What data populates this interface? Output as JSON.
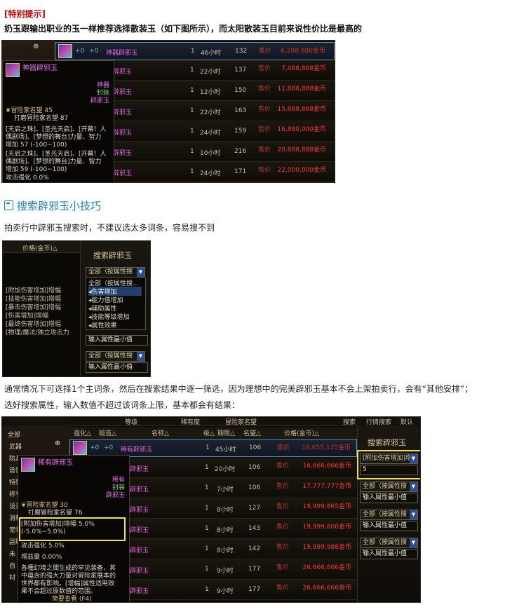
{
  "header": {
    "tag": "[特别提示]",
    "intro": "奶玉跟输出职业的玉一样推荐选择散装玉（如下图所示），而太阳散装玉目前来说性价比是最高的"
  },
  "shot1": {
    "rows": [
      {
        "qty": "1",
        "time": "46小时",
        "fame": "132",
        "sell": "售价",
        "price": "6,288,880金币",
        "name": "神器辟邪玉",
        "p1": "+0",
        "p2": "+0"
      },
      {
        "qty": "1",
        "time": "22小时",
        "fame": "137",
        "sell": "售价",
        "price": "7,488,888金币"
      },
      {
        "qty": "1",
        "time": "12小时",
        "fame": "150",
        "sell": "售价",
        "price": "11,888,888金币"
      },
      {
        "qty": "1",
        "time": "22小时",
        "fame": "163",
        "sell": "售价",
        "price": "15,888,888金币"
      },
      {
        "qty": "1",
        "time": "24小时",
        "fame": "159",
        "sell": "售价",
        "price": "16,880,000金币"
      },
      {
        "qty": "1",
        "time": "10小时",
        "fame": "216",
        "sell": "售价",
        "price": "20,888,888金币"
      },
      {
        "qty": "1",
        "time": "24小时",
        "fame": "171",
        "sell": "售价",
        "price": "22,000,000金币"
      }
    ],
    "name_fragments": [
      "辟邪玉",
      "辟邪玉",
      "辟邪玉",
      "辟邪玉",
      "辟邪玉",
      "辟邪玉"
    ],
    "tooltip": {
      "title": "神器辟邪玉",
      "grade": "神器",
      "type": "封装",
      "kind": "辟邪玉",
      "fame": "冒险家名望 45",
      "fame2": "打磨冒险家名望 87",
      "l1": "[天启之珠]、[圣光天启]、[开幕！人",
      "l2": "偶剧场]、[梦想的舞台]力量、智力",
      "l3": "增加 57 (-100~100)",
      "l4": "[天启之珠]、[圣光天启]、[开幕！人",
      "l5": "偶剧场]、[梦想的舞台]力量、智力",
      "l6": "增加 59 (-100~100)",
      "l7": "攻击强化 0.0%"
    }
  },
  "section": {
    "title": "搜索辟邪玉小技巧",
    "tip": "拍卖行中辟邪玉搜索时，不建议选太多词条，容易搜不到"
  },
  "shot2": {
    "col_header": "价格(金币)△",
    "panel_title": "搜索辟邪玉",
    "dropdown1": "全部（按属性搜",
    "menu": [
      "全部（按属性搜...",
      "伤害增加",
      "能力值增加",
      "辅助属性",
      "技能等级增加",
      "属性效果"
    ],
    "left_list": [
      "[附加伤害增加]增幅",
      "[技能伤害增加]增幅",
      "[暴击伤害增加]增幅",
      "[伤害增加]增幅",
      "[最终伤害增加]增幅",
      "[物理/魔法/独立攻击力"
    ],
    "input1": "输入属性最小值",
    "dropdown2": "全部（按属性搜",
    "input2": "输入属性最小值"
  },
  "para": {
    "line1": "通常情况下可选择1个主词条，然后在搜索结果中逐一筛选，因为理想中的完美辟邪玉基本不会上架拍卖行，会有“其他安排”；",
    "line2": "选好搜索属性，输入数值不超过该词条上限，基本都会有结果："
  },
  "shot3": {
    "top": [
      "等级",
      "稀有度",
      "冒险家名望",
      "搜索",
      "行情搜索",
      "默认"
    ],
    "headers": [
      "强化△",
      "锻造△",
      "名称△",
      "级△",
      "期限△",
      "名望△",
      "价格(金币)△"
    ],
    "left": [
      "全部",
      "武器",
      "防具",
      "首饰",
      "特殊",
      "称号",
      "设计",
      "消耗",
      "宠物",
      "副职",
      "未",
      "自",
      "材"
    ],
    "panel_title": "搜索辟邪玉",
    "dropdown_sel": "[附加伤害增加]增",
    "input_val": "5",
    "dropdowns": [
      "全部（按属性搜",
      "全部（按属性搜",
      "全部（按属性搜"
    ],
    "inputs": [
      "输入属性最小值",
      "输入属性最小值",
      "输入属性最小值"
    ],
    "rows": [
      {
        "name": "稀有辟邪玉",
        "p1": "+0",
        "p2": "+0",
        "qty": "1",
        "time": "45小时",
        "fame": "106",
        "sell": "售价",
        "price": "16,655,125金币"
      },
      {
        "qty": "1",
        "time": "20小时",
        "fame": "106",
        "sell": "售价",
        "price": "16,666,666金币"
      },
      {
        "qty": "1",
        "time": "7小时",
        "fame": "106",
        "sell": "售价",
        "price": "17,777,777金币"
      },
      {
        "qty": "1",
        "time": "8小时",
        "fame": "127",
        "sell": "售价",
        "price": "19,999,865金币"
      },
      {
        "qty": "1",
        "time": "8小时",
        "fame": "143",
        "sell": "售价",
        "price": "19,999,800金币"
      },
      {
        "qty": "1",
        "time": "8小时",
        "fame": "142",
        "sell": "售价",
        "price": "19,999,988金币"
      },
      {
        "qty": "1",
        "time": "9小时",
        "fame": "177",
        "sell": "售价",
        "price": "26,666,666金币"
      },
      {
        "qty": "1",
        "time": "9小时",
        "fame": "177",
        "sell": "售价",
        "price": "26,666,666金币"
      }
    ],
    "name_fragments": [
      "辟邪玉",
      "辟邪玉",
      "辟邪玉",
      "辟邪玉",
      "辟邪玉",
      "辟邪玉",
      "辟邪玉"
    ],
    "tooltip": {
      "title": "稀有辟邪玉",
      "grade": "稀有",
      "type": "封装",
      "kind": "辟邪玉",
      "fame": "冒险家名望 30",
      "fame2": "打磨冒险家名望 76",
      "attr": "[附加伤害增加]增幅 5.0% (-5.0%~5.0%)",
      "atk": "攻击强化 5.0%",
      "amp": "增益量 0.00%",
      "d1": "各種幻境之間生成的罕见装备，其",
      "d2": "中蕴含的强大力量对冒险家展本的",
      "d3": "世界都有影响。[增幅]属性适用效",
      "d4": "果不会超过原数值的范围。",
      "foot": "简要查看 (F4)"
    }
  }
}
